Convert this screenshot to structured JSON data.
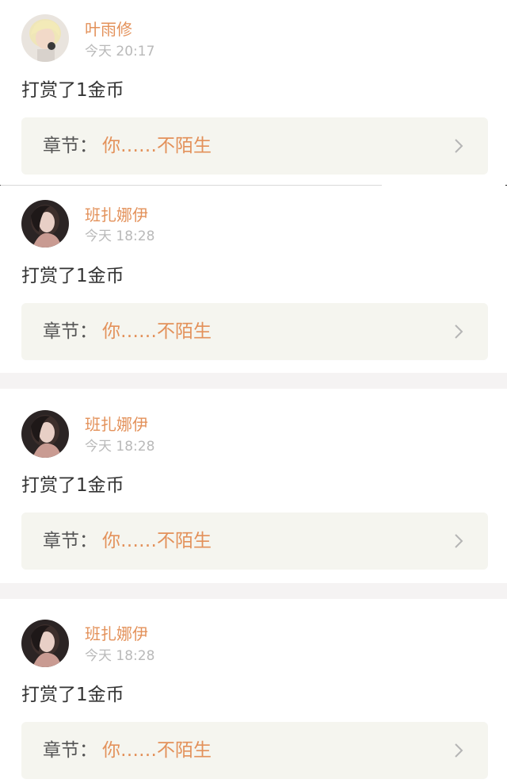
{
  "records": [
    {
      "username": "叶雨修",
      "time": "今天 20:17",
      "reward_text": "打赏了1金币",
      "chapter_label": "章节：",
      "chapter_title": "你……不陌生",
      "avatar_icon": "avatar-blond-user"
    },
    {
      "username": "班扎娜伊",
      "time": "今天 18:28",
      "reward_text": "打赏了1金币",
      "chapter_label": "章节：",
      "chapter_title": "你……不陌生",
      "avatar_icon": "avatar-dark-hair-user"
    },
    {
      "username": "班扎娜伊",
      "time": "今天 18:28",
      "reward_text": "打赏了1金币",
      "chapter_label": "章节：",
      "chapter_title": "你……不陌生",
      "avatar_icon": "avatar-dark-hair-user"
    },
    {
      "username": "班扎娜伊",
      "time": "今天 18:28",
      "reward_text": "打赏了1金币",
      "chapter_label": "章节：",
      "chapter_title": "你……不陌生",
      "avatar_icon": "avatar-dark-hair-user"
    }
  ],
  "colors": {
    "accent": "#e3915a",
    "time_gray": "#b9b9b9",
    "chapter_bg": "#f5f5ef",
    "separator": "#f5f3f3"
  }
}
